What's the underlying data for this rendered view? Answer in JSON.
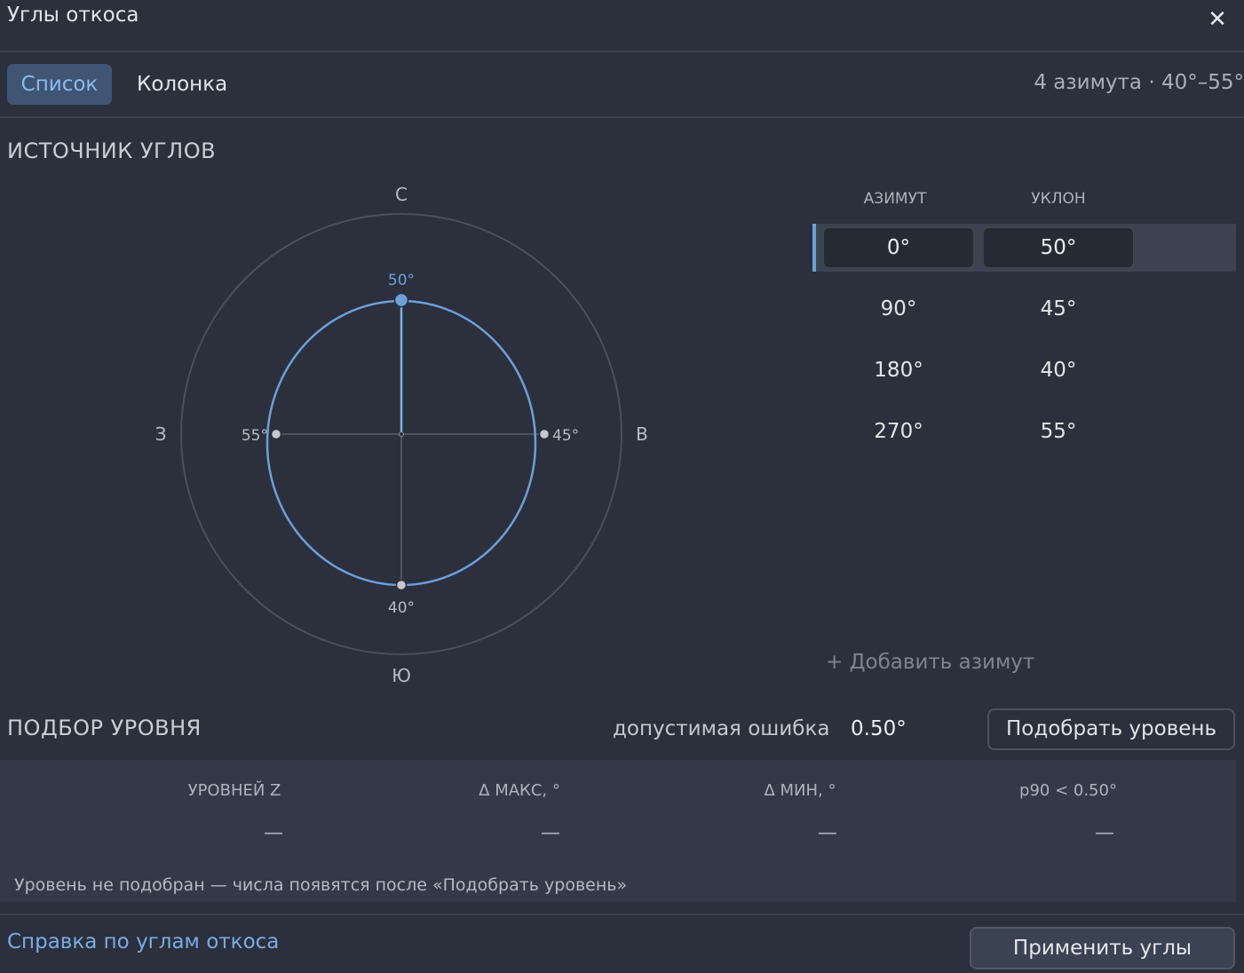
{
  "dialog": {
    "title": "Углы откоса",
    "close_glyph": "✕"
  },
  "tabs": [
    {
      "label": "Список",
      "active": true
    },
    {
      "label": "Колонка",
      "active": false
    }
  ],
  "summary": "4 азимута · 40°–55°",
  "source": {
    "heading": "ИСТОЧНИК УГЛОВ",
    "compass": {
      "labels": {
        "north": "С",
        "east": "В",
        "south": "Ю",
        "west": "З"
      },
      "points": [
        {
          "azimuth": 0,
          "label": "50°",
          "selected": true
        },
        {
          "azimuth": 90,
          "label": "45°",
          "selected": false
        },
        {
          "azimuth": 180,
          "label": "40°",
          "selected": false
        },
        {
          "azimuth": 270,
          "label": "55°",
          "selected": false
        }
      ],
      "accent": "#6e9fd8",
      "point_color": "#c4c8cf"
    },
    "table": {
      "headers": {
        "azimuth": "АЗИМУТ",
        "slope": "УКЛОН"
      },
      "rows": [
        {
          "azimuth": "0°",
          "slope": "50°"
        },
        {
          "azimuth": "90°",
          "slope": "45°"
        },
        {
          "azimuth": "180°",
          "slope": "40°"
        },
        {
          "azimuth": "270°",
          "slope": "55°"
        }
      ],
      "selected_index": 0
    },
    "add_label": "+  Добавить азимут"
  },
  "level": {
    "heading": "ПОДБОР УРОВНЯ",
    "tolerance_label": "допустимая ошибка",
    "tolerance_value": "0.50°",
    "fit_button": "Подобрать уровень",
    "stats": [
      {
        "label": "УРОВНЕЙ Z",
        "value": "—"
      },
      {
        "label": "Δ МАКС, °",
        "value": "—"
      },
      {
        "label": "Δ МИН, °",
        "value": "—"
      },
      {
        "label": "p90 < 0.50°",
        "value": "—"
      }
    ],
    "note": "Уровень не подобран — числа появятся после «Подобрать уровень»"
  },
  "footer": {
    "help_link": "Справка по углам откоса",
    "apply_button": "Применить углы"
  }
}
